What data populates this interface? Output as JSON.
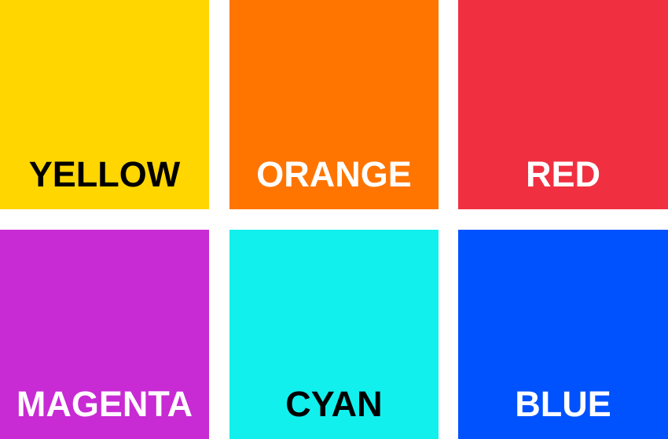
{
  "swatches": [
    {
      "label": "YELLOW",
      "color": "#FFD600",
      "text_color": "#000000"
    },
    {
      "label": "ORANGE",
      "color": "#FF7500",
      "text_color": "#FFFFFF"
    },
    {
      "label": "RED",
      "color": "#F03040",
      "text_color": "#FFFFFF"
    },
    {
      "label": "MAGENTA",
      "color": "#C82AD4",
      "text_color": "#FFFFFF"
    },
    {
      "label": "CYAN",
      "color": "#12F0EE",
      "text_color": "#000000"
    },
    {
      "label": "BLUE",
      "color": "#0052FF",
      "text_color": "#FFFFFF"
    }
  ]
}
